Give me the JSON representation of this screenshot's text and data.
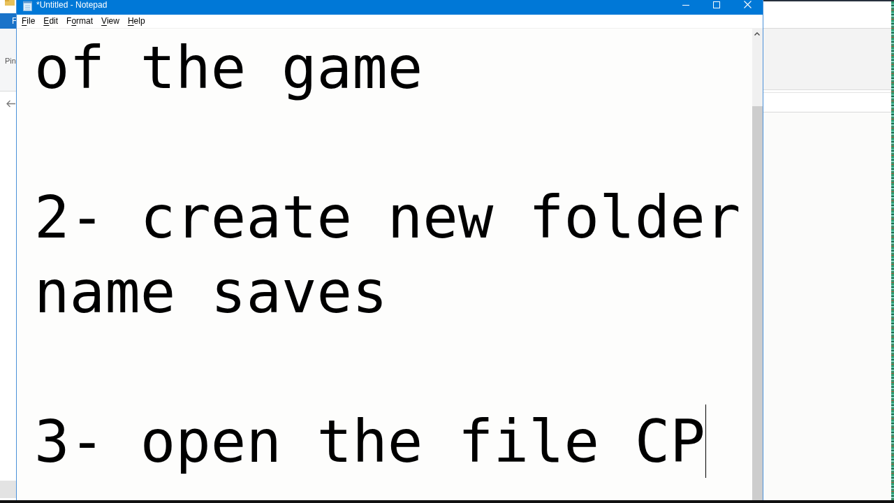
{
  "background_window": {
    "ribbon_tab": "F",
    "ribbon_label": "Pin"
  },
  "window": {
    "title": "*Untitled - Notepad"
  },
  "menu": [
    {
      "label": "File",
      "access_key_letters": [
        true,
        false,
        false,
        false
      ]
    },
    {
      "label": "Edit",
      "access_key_letters": [
        true,
        false,
        false,
        false
      ]
    },
    {
      "label": "Format",
      "access_key_letters": [
        false,
        true,
        false,
        false,
        false,
        false
      ]
    },
    {
      "label": "View",
      "access_key_letters": [
        true,
        false,
        false,
        false
      ]
    },
    {
      "label": "Help",
      "access_key_letters": [
        true,
        false,
        false,
        false
      ]
    }
  ],
  "document": {
    "paragraphs": [
      {
        "text": "of the game",
        "caret_after": false
      },
      {
        "text": "2- create new folder name saves",
        "caret_after": false
      },
      {
        "text": "3- open the file CP",
        "caret_after": true
      }
    ]
  }
}
